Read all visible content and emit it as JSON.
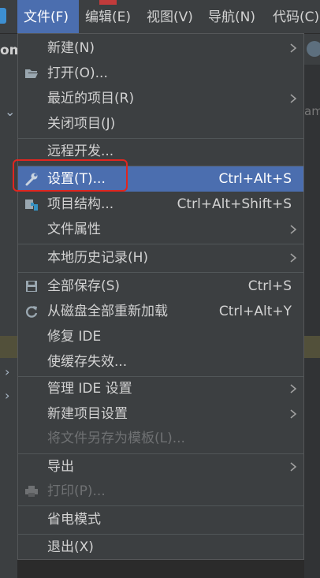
{
  "menubar": {
    "items": [
      {
        "label": "文件(F)",
        "active": true
      },
      {
        "label": "编辑(E)"
      },
      {
        "label": "视图(V)"
      },
      {
        "label": "导航(N)"
      },
      {
        "label": "代码(C)"
      }
    ]
  },
  "background": {
    "left_text": "om",
    "right_text": "am"
  },
  "file_menu": {
    "items": [
      {
        "label": "新建(N)",
        "submenu": true
      },
      {
        "label": "打开(O)...",
        "icon": "folder-open-icon"
      },
      {
        "label": "最近的项目(R)",
        "submenu": true
      },
      {
        "label": "关闭项目(J)"
      },
      {
        "label": "远程开发..."
      },
      {
        "label": "设置(T)...",
        "shortcut": "Ctrl+Alt+S",
        "icon": "wrench-icon",
        "selected": true
      },
      {
        "label": "项目结构...",
        "shortcut": "Ctrl+Alt+Shift+S",
        "icon": "project-structure-icon"
      },
      {
        "label": "文件属性",
        "submenu": true
      },
      {
        "label": "本地历史记录(H)",
        "submenu": true
      },
      {
        "label": "全部保存(S)",
        "shortcut": "Ctrl+S",
        "icon": "save-icon"
      },
      {
        "label": "从磁盘全部重新加载",
        "shortcut": "Ctrl+Alt+Y",
        "icon": "reload-icon"
      },
      {
        "label": "修复 IDE"
      },
      {
        "label": "使缓存失效..."
      },
      {
        "label": "管理 IDE 设置",
        "submenu": true
      },
      {
        "label": "新建项目设置",
        "submenu": true
      },
      {
        "label": "将文件另存为模板(L)...",
        "disabled": true
      },
      {
        "label": "导出",
        "submenu": true
      },
      {
        "label": "打印(P)...",
        "icon": "print-icon",
        "disabled": true
      },
      {
        "label": "省电模式"
      },
      {
        "label": "退出(X)"
      }
    ]
  },
  "colors": {
    "selection": "#4b6eaf",
    "menu_bg": "#3c3f41",
    "highlight_outline": "#e0261f"
  }
}
